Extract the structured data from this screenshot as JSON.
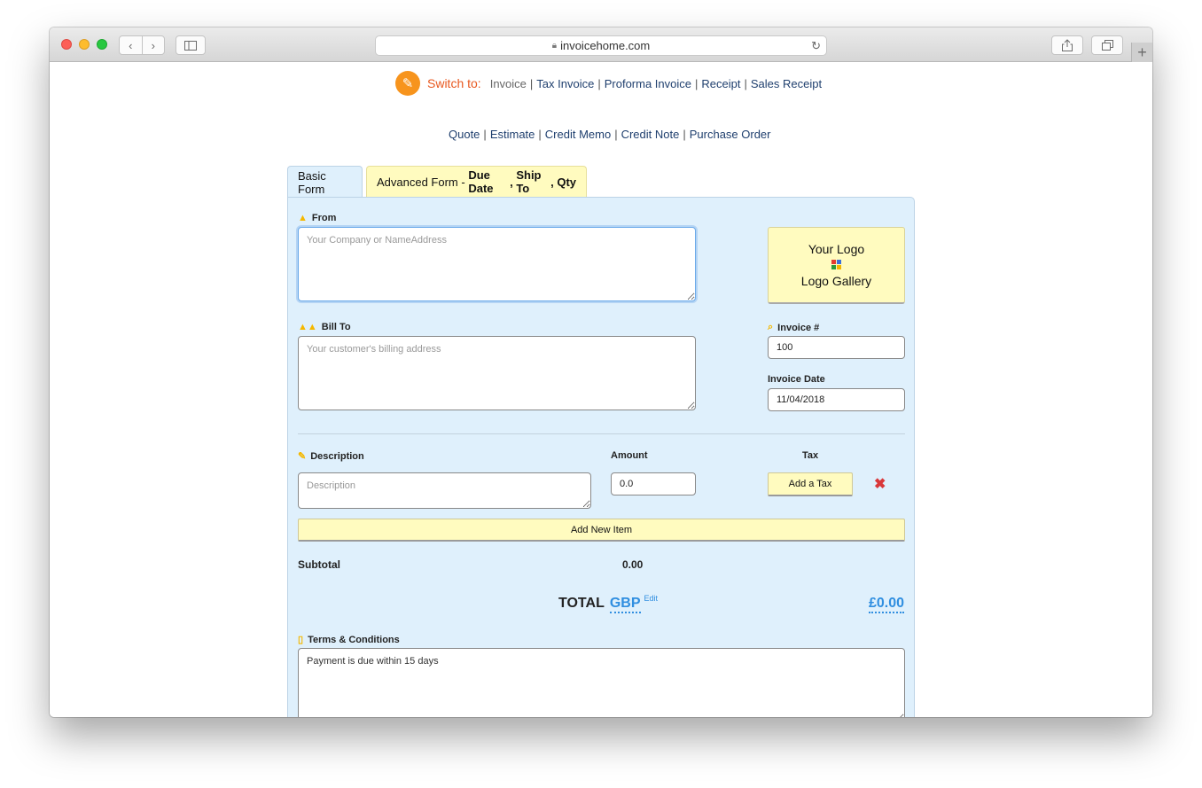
{
  "browser": {
    "url": "invoicehome.com"
  },
  "switcher": {
    "label": "Switch to:",
    "row1": [
      "Invoice",
      "Tax Invoice",
      "Proforma Invoice",
      "Receipt",
      "Sales Receipt"
    ],
    "row2": [
      "Quote",
      "Estimate",
      "Credit Memo",
      "Credit Note",
      "Purchase Order"
    ],
    "separator": "|",
    "current": "Invoice"
  },
  "tabs": {
    "basic": "Basic Form",
    "advanced_prefix": "Advanced Form - ",
    "advanced_due": "Due Date",
    "advanced_comma1": ", ",
    "advanced_ship": "Ship To",
    "advanced_comma2": ", ",
    "advanced_qty": "Qty"
  },
  "form": {
    "from_label": "From",
    "from_placeholder": "Your Company or NameAddress",
    "logo_line1": "Your Logo",
    "logo_line2": "Logo Gallery",
    "bill_to_label": "Bill To",
    "bill_to_placeholder": "Your customer's billing address",
    "invoice_number_label": "Invoice #",
    "invoice_number_value": "100",
    "invoice_date_label": "Invoice Date",
    "invoice_date_value": "11/04/2018",
    "description_label": "Description",
    "amount_label": "Amount",
    "tax_label": "Tax",
    "description_placeholder": "Description",
    "amount_value": "0.0",
    "add_tax_label": "Add a Tax",
    "add_item_label": "Add New Item",
    "subtotal_label": "Subtotal",
    "subtotal_value": "0.00",
    "total_label": "TOTAL",
    "currency": "GBP",
    "edit_label": "Edit",
    "total_amount": "£0.00",
    "terms_label": "Terms & Conditions",
    "terms_value": "Payment is due within 15 days"
  },
  "colors": {
    "panel_bg": "#dff0fc",
    "button_yellow": "#fffbbf",
    "link_blue": "#2f8ee0",
    "switch_orange": "#e8571e",
    "icon_orange": "#f7941d",
    "delete_red": "#d9383a"
  }
}
